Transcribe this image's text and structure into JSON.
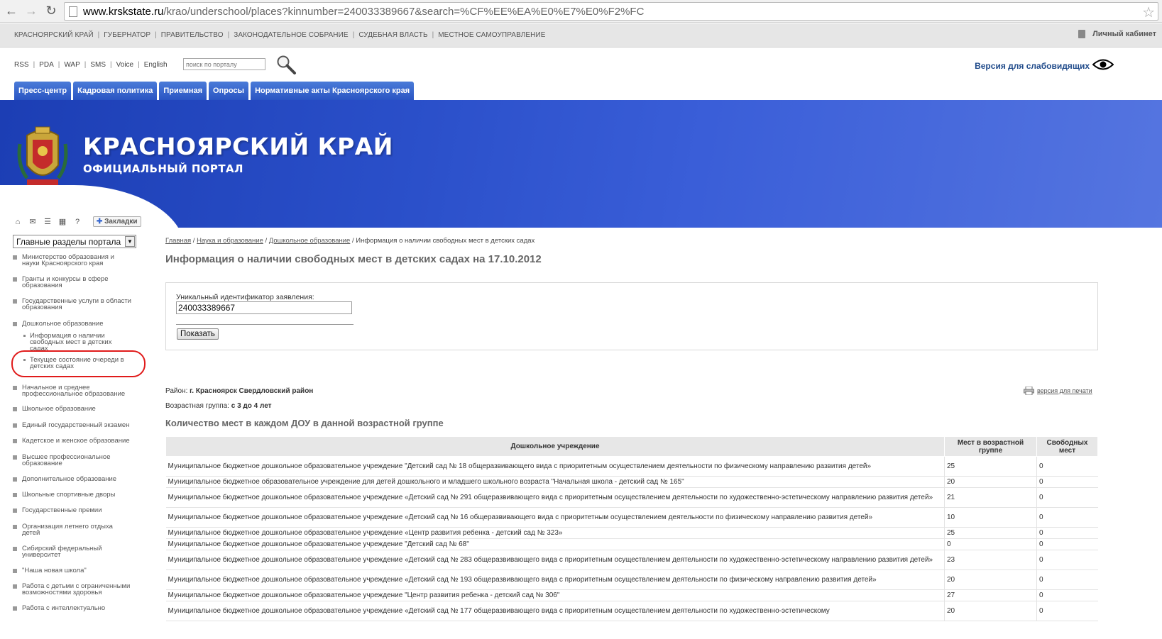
{
  "browser": {
    "url_host": "www.krskstate.ru",
    "url_path": "/krao/underschool/places?kinnumber=240033389667&search=%CF%EE%EA%E0%E7%E0%F2%FC"
  },
  "top_nav": {
    "items": [
      "КРАСНОЯРСКИЙ КРАЙ",
      "ГУБЕРНАТОР",
      "ПРАВИТЕЛЬСТВО",
      "ЗАКОНОДАТЕЛЬНОЕ СОБРАНИЕ",
      "СУДЕБНАЯ ВЛАСТЬ",
      "МЕСТНОЕ САМОУПРАВЛЕНИЕ"
    ],
    "cabinet": "Личный кабинет"
  },
  "util_links": [
    "RSS",
    "PDA",
    "WAP",
    "SMS",
    "Voice",
    "English"
  ],
  "search": {
    "placeholder": "поиск по порталу"
  },
  "vision_link": "Версия для слабовидящих",
  "tabs": [
    "Пресс-центр",
    "Кадровая политика",
    "Приемная",
    "Опросы",
    "Нормативные акты Красноярского края"
  ],
  "banner": {
    "title": "КРАСНОЯРСКИЙ КРАЙ",
    "subtitle": "ОФИЦИАЛЬНЫЙ ПОРТАЛ"
  },
  "sidebar": {
    "bookmarks": "Закладки",
    "select_value": "Главные разделы портала",
    "items": [
      {
        "label": "Министерство образования и науки Красноярского края"
      },
      {
        "label": "Гранты и конкурсы в сфере образования"
      },
      {
        "label": "Государственные услуги в области образования"
      },
      {
        "label": "Дошкольное образование"
      },
      {
        "label": "Информация о наличии свободных мест в детских садах"
      },
      {
        "label": "Текущее состояние очереди в детских садах"
      },
      {
        "label": "Начальное и среднее профессиональное образование"
      },
      {
        "label": "Школьное образование"
      },
      {
        "label": "Единый государственный экзамен"
      },
      {
        "label": "Кадетское и женское образование"
      },
      {
        "label": "Высшее профессиональное образование"
      },
      {
        "label": "Дополнительное образование"
      },
      {
        "label": "Школьные спортивные дворы"
      },
      {
        "label": "Государственные премии"
      },
      {
        "label": "Организация летнего отдыха детей"
      },
      {
        "label": "Сибирский федеральный университет"
      },
      {
        "label": "\"Наша новая школа\""
      },
      {
        "label": "Работа с детьми с ограниченными возможностями здоровья"
      },
      {
        "label": "Работа с интеллектуально"
      }
    ]
  },
  "breadcrumb": {
    "links": [
      "Главная",
      "Наука и образование",
      "Дошкольное образование"
    ],
    "current": "Информация о наличии свободных мест в детских садах"
  },
  "page_title": "Информация о наличии свободных мест в детских садах на 17.10.2012",
  "form": {
    "label": "Уникальный идентификатор заявления:",
    "value": "240033389667",
    "button": "Показать"
  },
  "district": {
    "label": "Район:",
    "value": "г. Красноярск Свердловский район"
  },
  "agegroup": {
    "label": "Возрастная группа:",
    "value": "с 3 до 4 лет"
  },
  "print_link": "версия для печати",
  "section_title": "Количество мест в каждом ДОУ в данной возрастной группе",
  "table": {
    "headers": [
      "Дошкольное учреждение",
      "Мест в возрастной группе",
      "Свободных мест"
    ],
    "rows": [
      {
        "name": "Муниципальное бюджетное дошкольное образовательное учреждение \"Детский сад № 18 общеразвивающего вида с приоритетным осуществлением деятельности по физическому направлению развития детей»",
        "places": "25",
        "free": "0"
      },
      {
        "name": "Муниципальное бюджетное образовательное учреждение для детей дошкольного и младшего школьного возраста \"Начальная школа - детский сад № 165\"",
        "places": "20",
        "free": "0"
      },
      {
        "name": "Муниципальное бюджетное дошкольное образовательное учреждение «Детский сад № 291 общеразвивающего вида с приоритетным осуществлением деятельности по художественно-эстетическому направлению развития детей»",
        "places": "21",
        "free": "0"
      },
      {
        "name": "Муниципальное бюджетное дошкольное образовательное учреждение «Детский сад № 16 общеразвивающего вида с приоритетным осуществлением деятельности по физическому направлению развития детей»",
        "places": "10",
        "free": "0"
      },
      {
        "name": "Муниципальное бюджетное дошкольное образовательное учреждение «Центр развития ребенка - детский сад № 323»",
        "places": "25",
        "free": "0"
      },
      {
        "name": "Муниципальное бюджетное дошкольное образовательное учреждение \"Детский сад № 68\"",
        "places": "0",
        "free": "0"
      },
      {
        "name": "Муниципальное бюджетное дошкольное образовательное учреждение «Детский сад № 283 общеразвивающего вида с приоритетным осуществлением деятельности по художественно-эстетическому направлению развития детей»",
        "places": "23",
        "free": "0"
      },
      {
        "name": "Муниципальное бюджетное дошкольное образовательное учреждение «Детский сад № 193 общеразвивающего вида с приоритетным осуществлением деятельности по физическому направлению развития детей»",
        "places": "20",
        "free": "0"
      },
      {
        "name": "Муниципальное бюджетное дошкольное образовательное учреждение \"Центр развития ребенка - детский сад № 306\"",
        "places": "27",
        "free": "0"
      },
      {
        "name": "Муниципальное бюджетное дошкольное образовательное учреждение «Детский сад № 177 общеразвивающего вида с приоритетным осуществлением деятельности по художественно-эстетическому",
        "places": "20",
        "free": "0"
      }
    ]
  },
  "colors": {
    "accent_blue": "#2a4fc9",
    "highlight_red": "#e01b1b"
  }
}
